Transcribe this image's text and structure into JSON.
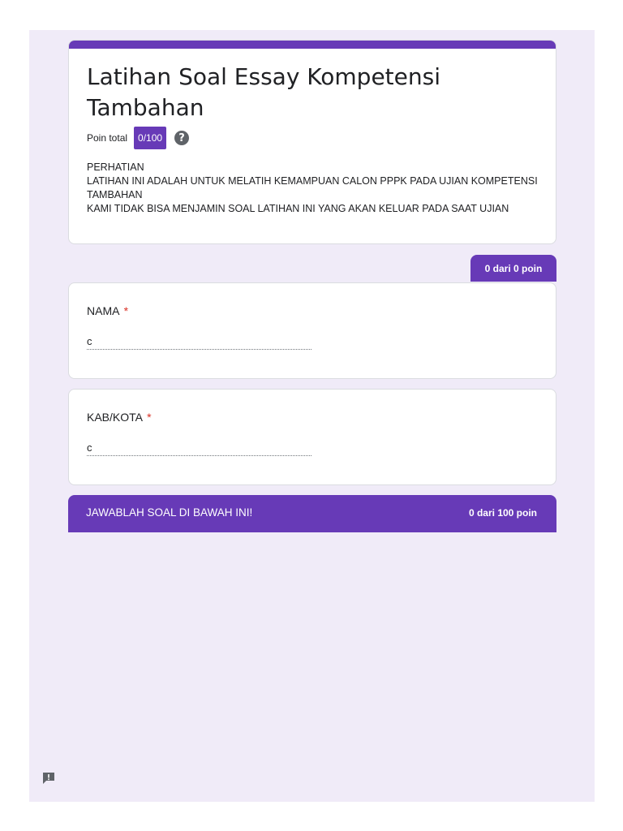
{
  "form": {
    "title": "Latihan Soal Essay Kompetensi Tambahan",
    "points_label": "Poin total",
    "points_value": "0/100",
    "help_icon": "help-circle-icon",
    "description_lines": [
      "PERHATIAN",
      "LATIHAN INI ADALAH UNTUK MELATIH KEMAMPUAN CALON PPPK PADA UJIAN KOMPETENSI TAMBAHAN",
      "KAMI TIDAK BISA MENJAMIN SOAL LATIHAN INI YANG AKAN KELUAR PADA SAAT UJIAN"
    ]
  },
  "section1": {
    "score": "0 dari 0 poin"
  },
  "questions": [
    {
      "label": "NAMA",
      "required_mark": "*",
      "answer": "c"
    },
    {
      "label": "KAB/KOTA",
      "required_mark": "*",
      "answer": "c"
    }
  ],
  "section2": {
    "title": "JAWABLAH SOAL DI BAWAH INI!",
    "score": "0 dari 100 poin"
  },
  "report": {
    "icon": "feedback-icon"
  },
  "colors": {
    "accent": "#673ab7",
    "background": "#f0ebf8",
    "required": "#d93025"
  }
}
